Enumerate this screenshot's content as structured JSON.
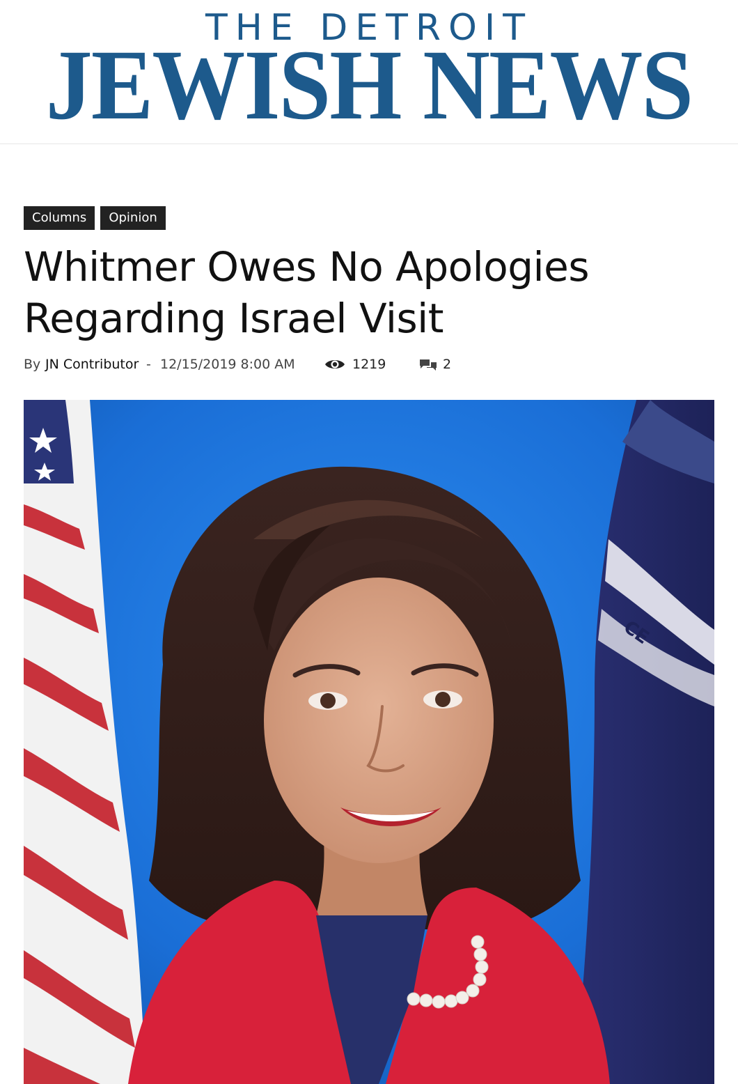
{
  "masthead": {
    "line1": "THE DETROIT",
    "line2": "JEWISH NEWS",
    "brand_color": "#1d5a8c"
  },
  "article": {
    "tags": [
      "Columns",
      "Opinion"
    ],
    "title_line1": "Whitmer Owes No Apologies",
    "title_line2": "Regarding Israel Visit",
    "meta": {
      "by": "By",
      "author": "JN Contributor",
      "separator": "-",
      "date": "12/15/2019 8:00 AM",
      "views_icon": "eye-icon",
      "views": "1219",
      "comments_icon": "comment-bubbles-icon",
      "comments": "2"
    },
    "featured_image": {
      "subject": "portrait-photo",
      "background_color": "#1d74d8"
    }
  }
}
